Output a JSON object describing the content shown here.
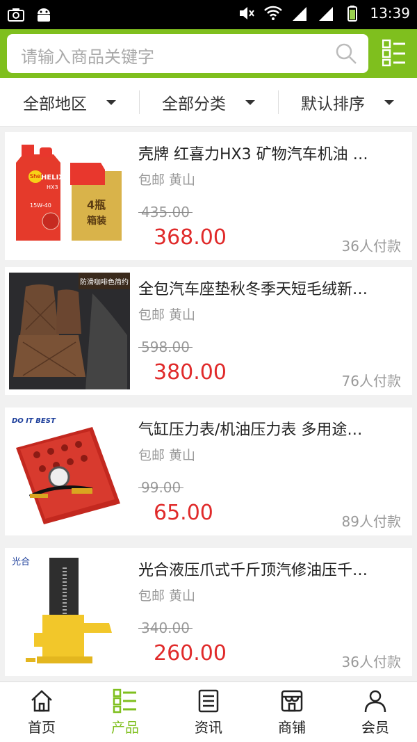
{
  "status_bar": {
    "time": "13:39"
  },
  "search": {
    "placeholder": "请输入商品关键字"
  },
  "filters": [
    {
      "label": "全部地区"
    },
    {
      "label": "全部分类"
    },
    {
      "label": "默认排序"
    }
  ],
  "products": [
    {
      "title": "壳牌 红喜力HX3 矿物汽车机油 …",
      "location": "包邮 黄山",
      "original_price": "435.00",
      "price": "368.00",
      "sales": "36人付款",
      "image_text": {
        "brand": "Shell",
        "product": "HELIX",
        "sub": "HX3",
        "viscosity": "15W-40",
        "pack": "4瓶",
        "pack2": "箱装"
      }
    },
    {
      "title": "全包汽车座垫秋冬季天短毛绒新…",
      "location": "包邮 黄山",
      "original_price": "598.00",
      "price": "380.00",
      "sales": "76人付款",
      "image_text": {
        "banner": "防滑咖啡色简约"
      }
    },
    {
      "title": "气缸压力表/机油压力表 多用途…",
      "location": "包邮 黄山",
      "original_price": "99.00",
      "price": "65.00",
      "sales": "89人付款",
      "image_text": {
        "brand": "DO IT BEST"
      }
    },
    {
      "title": "光合液压爪式千斤顶汽修油压千…",
      "location": "包邮 黄山",
      "original_price": "340.00",
      "price": "260.00",
      "sales": "36人付款",
      "image_text": {
        "brand": "光合"
      }
    }
  ],
  "bottom_nav": [
    {
      "label": "首页",
      "icon": "home-icon",
      "active": false
    },
    {
      "label": "产品",
      "icon": "grid-list-icon",
      "active": true
    },
    {
      "label": "资讯",
      "icon": "news-icon",
      "active": false
    },
    {
      "label": "商铺",
      "icon": "store-icon",
      "active": false
    },
    {
      "label": "会员",
      "icon": "user-icon",
      "active": false
    }
  ],
  "colors": {
    "accent": "#7fbf1e",
    "price": "#e02a2a"
  }
}
